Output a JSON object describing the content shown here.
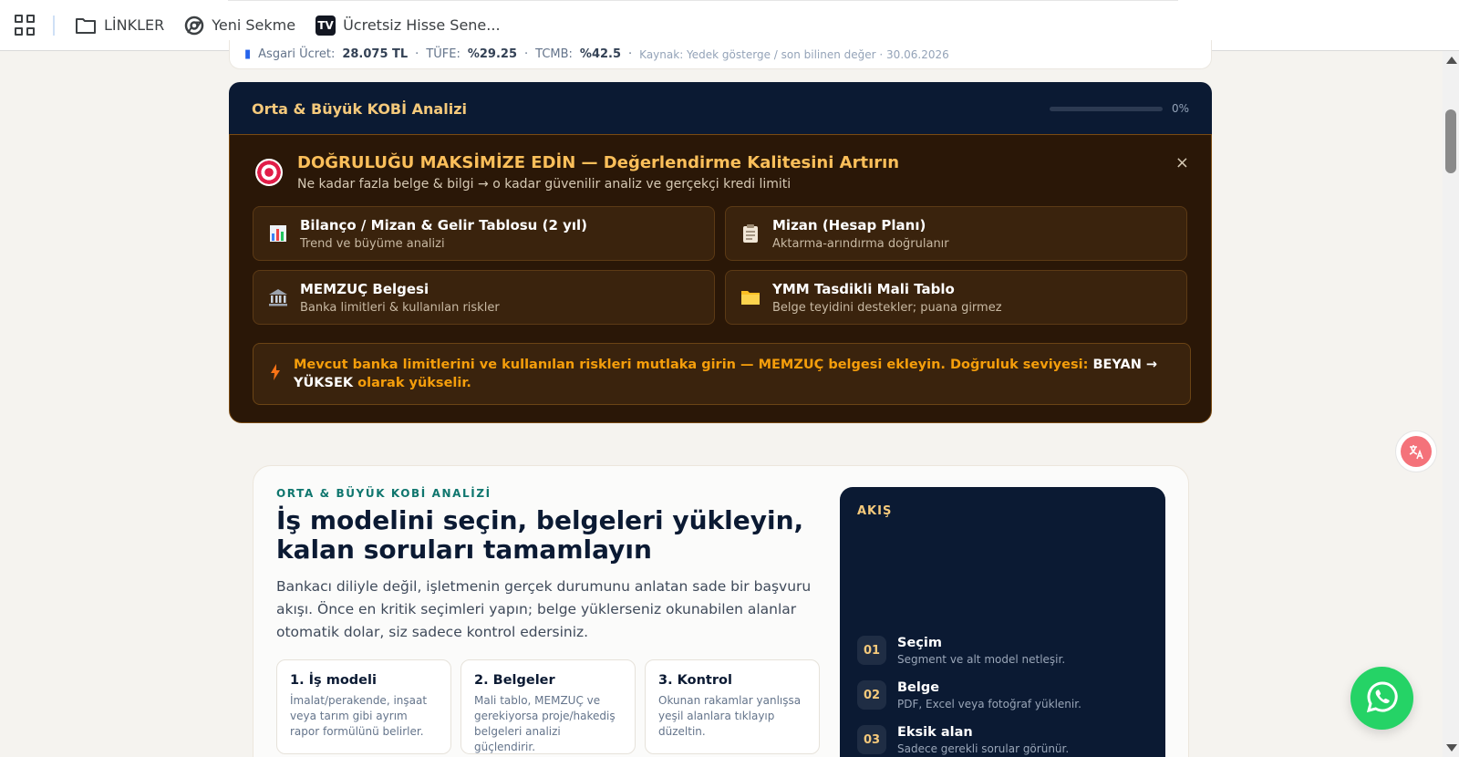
{
  "bookmarks": {
    "items": [
      {
        "label": "LİNKLER",
        "icon": "folder-icon"
      },
      {
        "label": "Yeni Sekme",
        "icon": "chrome-icon"
      },
      {
        "label": "Ücretsiz Hisse Sene...",
        "icon": "tradingview-icon"
      }
    ]
  },
  "indicators": {
    "min_wage_label": "Asgari Ücret:",
    "min_wage_value": "28.075 TL",
    "cpi_label": "TÜFE:",
    "cpi_value": "%29.25",
    "cbrt_label": "TCMB:",
    "cbrt_value": "%42.5",
    "source": "Kaynak: Yedek gösterge / son bilinen değer · 30.06.2026"
  },
  "header": {
    "title": "Orta & Büyük KOBİ Analizi",
    "progress_percent": 0,
    "progress_label": "0%"
  },
  "accuracy": {
    "title": "DOĞRULUĞU MAKSİMİZE EDİN — Değerlendirme Kalitesini Artırın",
    "subtitle": "Ne kadar fazla belge & bilgi → o kadar güvenilir analiz ve gerçekçi kredi limiti",
    "close": "×",
    "docs": [
      {
        "title": "Bilanço / Mizan & Gelir Tablosu (2 yıl)",
        "desc": "Trend ve büyüme analizi",
        "icon": "bar-chart-icon"
      },
      {
        "title": "Mizan (Hesap Planı)",
        "desc": "Aktarma-arındırma doğrulanır",
        "icon": "clipboard-icon"
      },
      {
        "title": "MEMZUÇ Belgesi",
        "desc": "Banka limitleri & kullanılan riskler",
        "icon": "bank-icon"
      },
      {
        "title": "YMM Tasdikli Mali Tablo",
        "desc": "Belge teyidini destekler; puana girmez",
        "icon": "folder-icon"
      }
    ],
    "warning": {
      "text_1": "Mevcut banka limitlerini ve kullanılan riskleri mutlaka girin — MEMZUÇ belgesi ekleyin. Doğruluk seviyesi:",
      "highlight": "BEYAN → YÜKSEK",
      "text_2": "olarak yükselir."
    }
  },
  "main": {
    "eyebrow": "ORTA & BÜYÜK KOBİ ANALİZİ",
    "title": "İş modelini seçin, belgeleri yükleyin, kalan soruları tamamlayın",
    "description": "Bankacı diliyle değil, işletmenin gerçek durumunu anlatan sade bir başvuru akışı. Önce en kritik seçimleri yapın; belge yüklerseniz okunabilen alanlar otomatik dolar, siz sadece kontrol edersiniz.",
    "steps": [
      {
        "title": "1. İş modeli",
        "desc": "İmalat/perakende, inşaat veya tarım gibi ayrım rapor formülünü belirler."
      },
      {
        "title": "2. Belgeler",
        "desc": "Mali tablo, MEMZUÇ ve gerekiyorsa proje/hakediş belgeleri analizi güçlendirir."
      },
      {
        "title": "3. Kontrol",
        "desc": "Okunan rakamlar yanlışsa yeşil alanlara tıklayıp düzeltin."
      }
    ],
    "flow": {
      "label": "AKIŞ",
      "items": [
        {
          "num": "01",
          "title": "Seçim",
          "desc": "Segment ve alt model netleşir."
        },
        {
          "num": "02",
          "title": "Belge",
          "desc": "PDF, Excel veya fotoğraf yüklenir."
        },
        {
          "num": "03",
          "title": "Eksik alan",
          "desc": "Sadece gerekli sorular görünür."
        }
      ]
    }
  },
  "colors": {
    "navy": "#0b1a33",
    "gold": "#f5c97b",
    "amber": "#f59e0b",
    "teal": "#0f766e",
    "whatsapp": "#25d366"
  }
}
